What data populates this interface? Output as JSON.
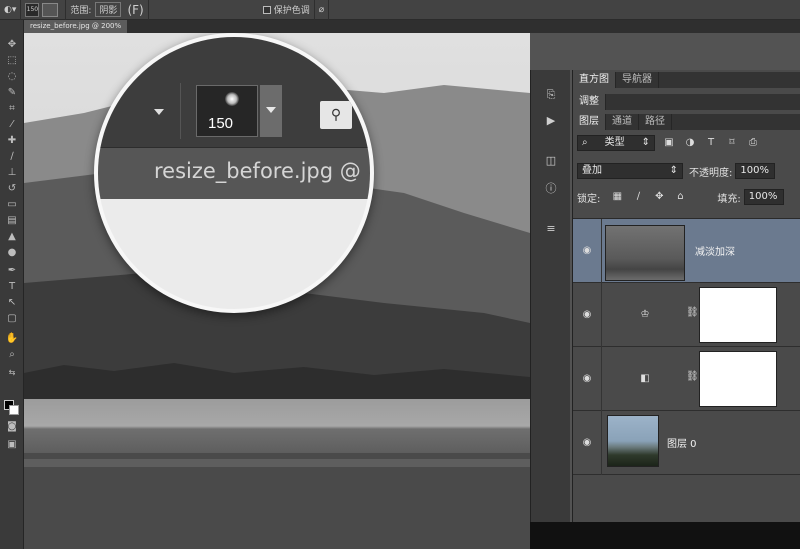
{
  "options_bar": {
    "brush_size": "150",
    "mode_label": "范围:",
    "mode_value": "阴影",
    "menu_fragment": "(F)",
    "protect_label": "保护色调"
  },
  "document": {
    "tab_title": "resize_before.jpg @ 200%"
  },
  "lens": {
    "brush_size": "150",
    "tab_title": "resize_before.jpg @"
  },
  "panels": {
    "row1_tabs": [
      "直方图",
      "导航器"
    ],
    "row2_tabs": [
      "调整"
    ],
    "row3_tabs": [
      "图层",
      "通道",
      "路径"
    ]
  },
  "layers": {
    "filter_label": "类型",
    "blend_mode": "叠加",
    "opacity_label": "不透明度:",
    "opacity_value": "100%",
    "lock_label": "锁定:",
    "fill_label": "填充:",
    "fill_value": "100%",
    "items": [
      {
        "name": "减淡加深",
        "selected": true
      },
      {
        "name": ""
      },
      {
        "name": ""
      },
      {
        "name": "图层 0"
      }
    ]
  },
  "colors": {
    "selected_layer": "#6b7a8f",
    "panel_bg": "#4a4a4a"
  }
}
